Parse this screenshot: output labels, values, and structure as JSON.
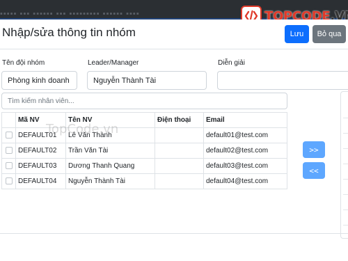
{
  "logo": {
    "brand": "TOPCODE",
    "domain": ".VN"
  },
  "modal": {
    "title": "Nhập/sửa thông tin nhóm",
    "save_label": "Lưu",
    "skip_label": "Bỏ qua"
  },
  "form": {
    "team_label": "Tên đội nhóm",
    "team_value": "Phòng kinh doanh",
    "leader_label": "Leader/Manager",
    "leader_value": "Nguyễn Thành Tài",
    "desc_label": "Diễn giải",
    "desc_value": ""
  },
  "search": {
    "placeholder": "Tìm kiếm nhân viên..."
  },
  "table": {
    "headers": [
      "Mã NV",
      "Tên NV",
      "Điện thoại",
      "Email"
    ],
    "rows": [
      {
        "code": "DEFAULT01",
        "name": "Lê Văn Thành",
        "phone": "",
        "email": "default01@test.com"
      },
      {
        "code": "DEFAULT02",
        "name": "Trần Văn Tài",
        "phone": "",
        "email": "default02@test.com"
      },
      {
        "code": "DEFAULT03",
        "name": "Dương Thanh Quang",
        "phone": "",
        "email": "default03@test.com"
      },
      {
        "code": "DEFAULT04",
        "name": "Nguyễn Thành Tài",
        "phone": "",
        "email": "default04@test.com"
      }
    ]
  },
  "transfer": {
    "add_label": ">>",
    "remove_label": "<<"
  },
  "watermark": "TopCode.vn",
  "colors": {
    "primary": "#0d6efd",
    "secondary": "#6c757d",
    "move": "#5ea7ff",
    "brand_red": "#e03a2a"
  }
}
